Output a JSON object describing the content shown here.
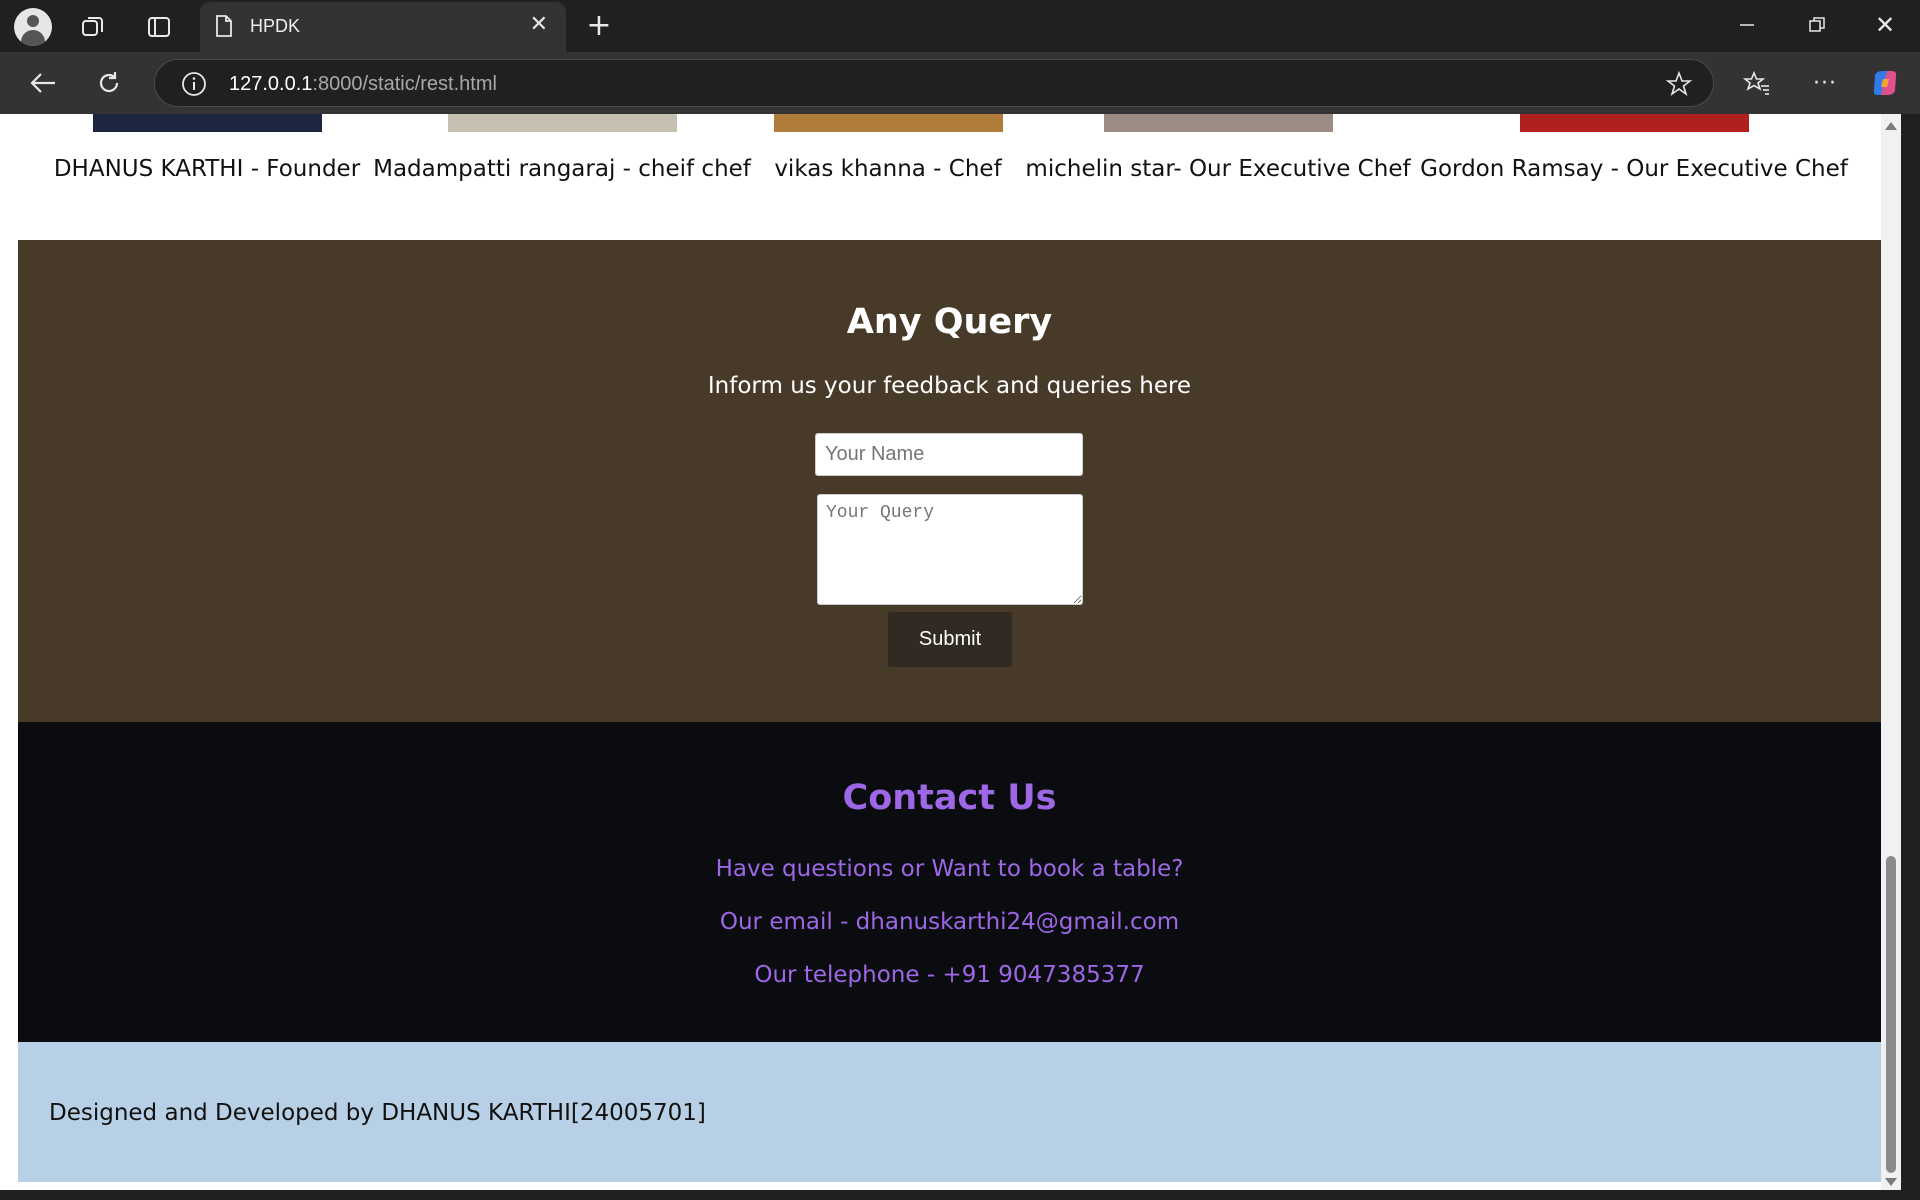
{
  "browser": {
    "tab_title": "HPDK",
    "url_host": "127.0.0.1",
    "url_rest": ":8000/static/rest.html"
  },
  "team": [
    {
      "caption": "DHANUS KARTHI - Founder",
      "photo_color": "#1c2640"
    },
    {
      "caption": "Madampatti rangaraj - cheif chef",
      "photo_color": "#c5bfb2"
    },
    {
      "caption": "vikas khanna - Chef",
      "photo_color": "#b07c3a"
    },
    {
      "caption": "michelin star- Our Executive Chef",
      "photo_color": "#9a8c82"
    },
    {
      "caption": "Gordon Ramsay - Our Executive Chef",
      "photo_color": "#b0201c"
    }
  ],
  "query": {
    "title": "Any Query",
    "subtitle": "Inform us your feedback and queries here",
    "name_placeholder": "Your Name",
    "query_placeholder": "Your Query",
    "submit_label": "Submit"
  },
  "contact": {
    "title": "Contact Us",
    "line1": "Have questions or Want to book a table?",
    "line2": "Our email - dhanuskarthi24@gmail.com",
    "line3": "Our telephone - +91 9047385377"
  },
  "footer": {
    "text": "Designed and Developed by DHANUS KARTHI[24005701]"
  },
  "colors": {
    "query_bg": "#483a28",
    "contact_bg": "#0b0c0f",
    "contact_text": "#9d67e6",
    "footer_bg": "#b7d0e5"
  }
}
